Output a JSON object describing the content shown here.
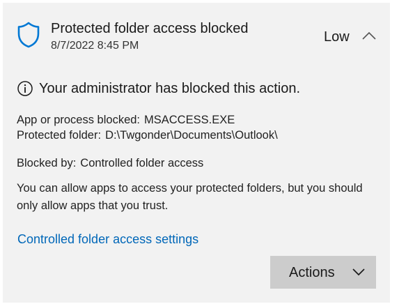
{
  "notification": {
    "icon": "shield-icon",
    "title": "Protected folder access blocked",
    "timestamp": "8/7/2022 8:45 PM",
    "severity": "Low",
    "collapse_icon": "chevron-up-icon"
  },
  "body": {
    "notice_icon": "info-icon",
    "notice": "Your administrator has blocked this action.",
    "details": [
      {
        "label": "App or process blocked:",
        "value": "MSACCESS.EXE"
      },
      {
        "label": "Protected folder:",
        "value": "D:\\Twgonder\\Documents\\Outlook\\"
      },
      {
        "label": "Blocked by:",
        "value": "Controlled folder access"
      }
    ],
    "paragraph": "You can allow apps to access your protected folders, but you should only allow apps that you trust.",
    "link": "Controlled folder access settings"
  },
  "footer": {
    "actions_label": "Actions",
    "actions_icon": "chevron-down-icon"
  },
  "colors": {
    "card_background": "#f2f2f2",
    "link": "#0067b8",
    "shield": "#0078d4",
    "button_background": "#cccccc"
  }
}
